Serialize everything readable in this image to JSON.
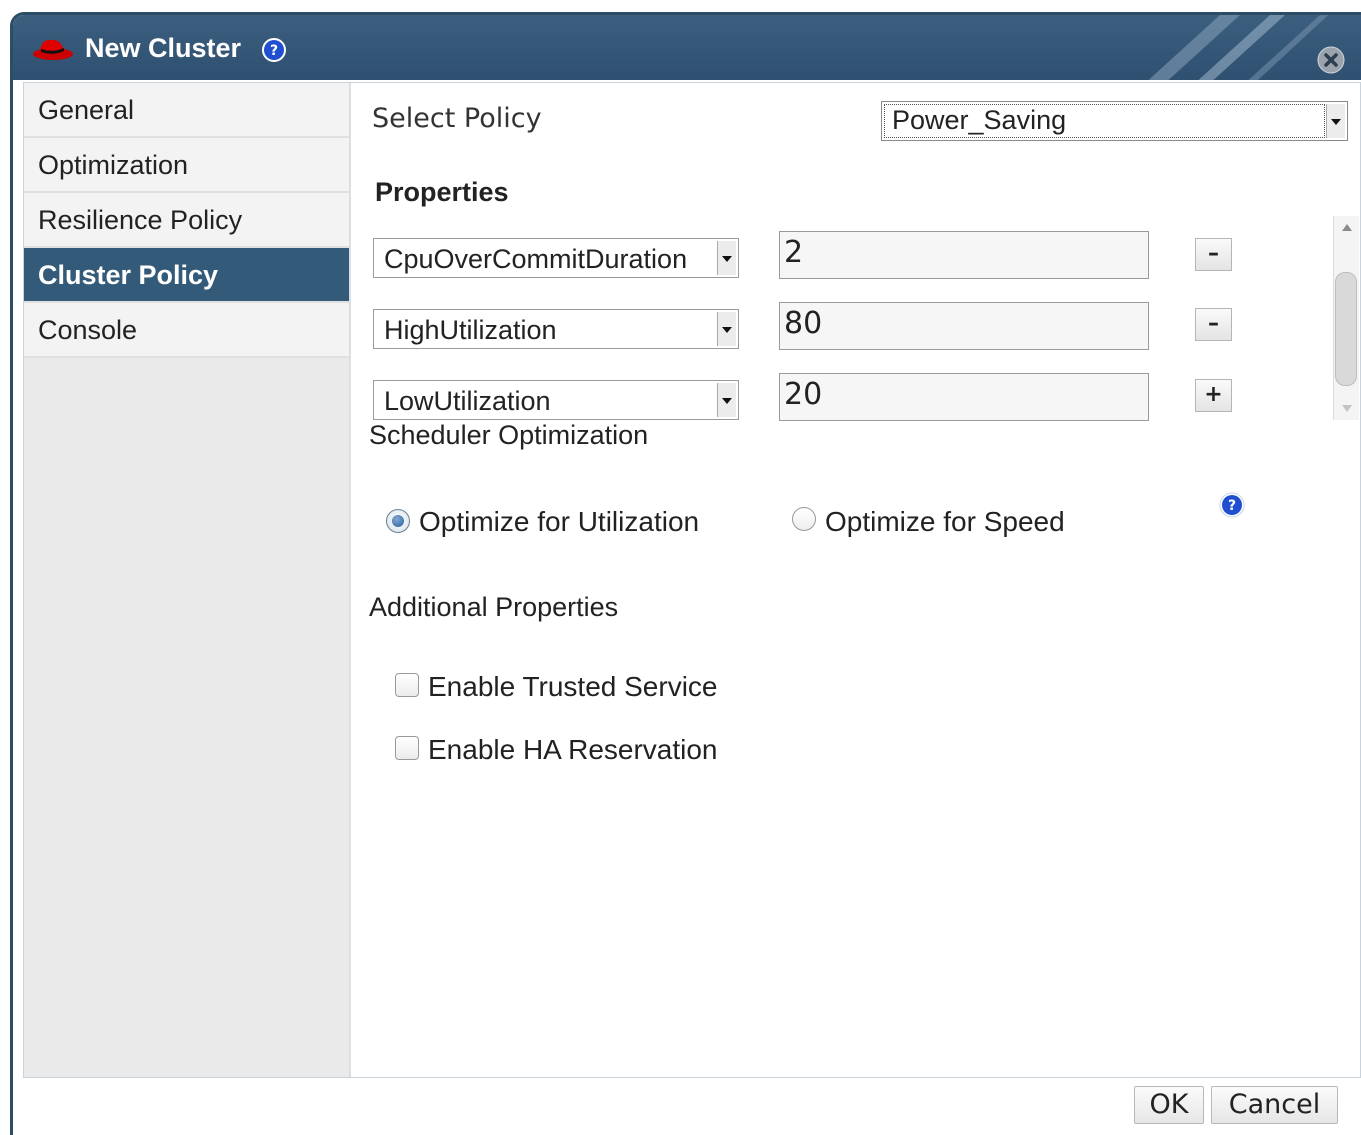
{
  "window": {
    "title": "New Cluster"
  },
  "sidebar": {
    "items": [
      {
        "label": "General"
      },
      {
        "label": "Optimization"
      },
      {
        "label": "Resilience Policy"
      },
      {
        "label": "Cluster Policy"
      },
      {
        "label": "Console"
      }
    ],
    "active": "Cluster Policy"
  },
  "policy": {
    "select_label": "Select Policy",
    "selected": "Power_Saving"
  },
  "properties": {
    "heading": "Properties",
    "rows": [
      {
        "key": "CpuOverCommitDuration",
        "value": "2",
        "button": "–"
      },
      {
        "key": "HighUtilization",
        "value": "80",
        "button": "–"
      },
      {
        "key": "LowUtilization",
        "value": "20",
        "button": "+"
      }
    ]
  },
  "scheduler": {
    "label": "Scheduler Optimization",
    "options": [
      {
        "label": "Optimize for Utilization",
        "selected": true
      },
      {
        "label": "Optimize for Speed",
        "selected": false
      }
    ]
  },
  "additional": {
    "label": "Additional Properties",
    "checkboxes": [
      {
        "label": "Enable Trusted Service",
        "checked": false
      },
      {
        "label": "Enable HA Reservation",
        "checked": false
      }
    ]
  },
  "footer": {
    "ok": "OK",
    "cancel": "Cancel"
  },
  "colors": {
    "titlebar": "#2f5070",
    "active_tab": "#345a79",
    "help_icon": "#1f4fd0"
  }
}
